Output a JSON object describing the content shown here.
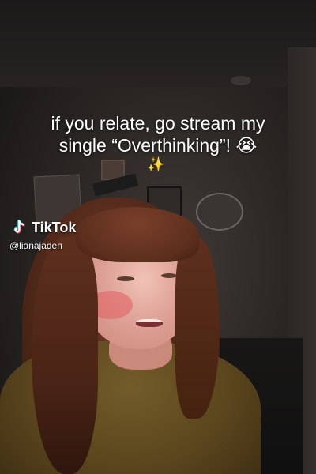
{
  "caption": {
    "line1": "if you relate, go stream my",
    "line2": "single “Overthinking”! 😭",
    "sparkle": "✨"
  },
  "watermark": {
    "logo_text": "TikTok",
    "handle": "@lianajaden",
    "icon": "tiktok-note-icon"
  },
  "colors": {
    "caption_text": "#ffffff",
    "tiktok_cyan": "#25f4ee",
    "tiktok_red": "#fe2c55"
  }
}
